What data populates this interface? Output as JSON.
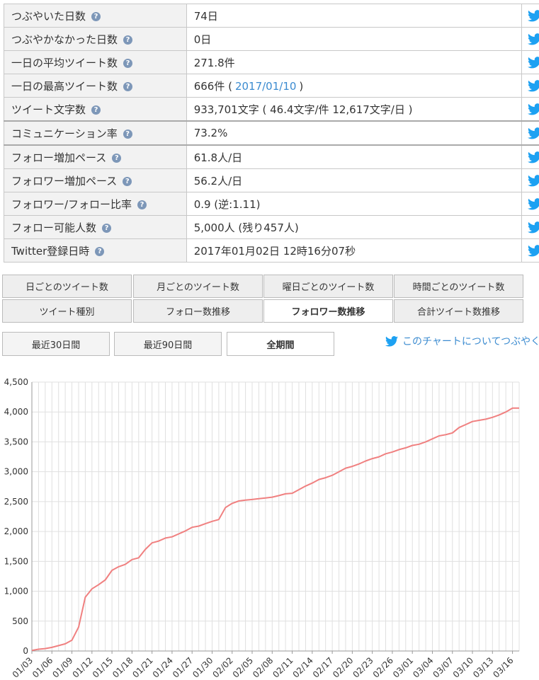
{
  "stats": [
    {
      "label": "つぶやいた日数",
      "value": "74日"
    },
    {
      "label": "つぶやかなかった日数",
      "value": "0日"
    },
    {
      "label": "一日の平均ツイート数",
      "value": "271.8件"
    },
    {
      "label": "一日の最高ツイート数",
      "value_pre": "666件 (",
      "value_link": "2017/01/10",
      "value_post": ")"
    },
    {
      "label": "ツイート文字数",
      "value": "933,701文字 ( 46.4文字/件 12,617文字/日 )"
    },
    {
      "label": "コミュニケーション率",
      "value": "73.2%"
    },
    {
      "label": "フォロー増加ペース",
      "value": "61.8人/日"
    },
    {
      "label": "フォロワー増加ペース",
      "value": "56.2人/日"
    },
    {
      "label": "フォロワー/フォロー比率",
      "value": "0.9 (逆:1.11)"
    },
    {
      "label": "フォロー可能人数",
      "value": "5,000人 (残り457人)"
    },
    {
      "label": "Twitter登録日時",
      "value": "2017年01月02日 12時16分07秒"
    }
  ],
  "help_glyph": "?",
  "tabs": {
    "row1": [
      "日ごとのツイート数",
      "月ごとのツイート数",
      "曜日ごとのツイート数",
      "時間ごとのツイート数"
    ],
    "row2": [
      "ツイート種別",
      "フォロー数推移",
      "フォロワー数推移",
      "合計ツイート数推移"
    ],
    "active": "フォロワー数推移"
  },
  "periods": {
    "labels": [
      "最近30日間",
      "最近90日間",
      "全期間"
    ],
    "active": "全期間"
  },
  "tweet_chart_link": "このチャートについてつぶやく",
  "colors": {
    "line": "#f08080",
    "twitter": "#1da1f2",
    "link": "#3b8bd0",
    "grid": "#e0e0e0",
    "axis": "#999999"
  },
  "chart_data": {
    "type": "line",
    "title": "",
    "xlabel": "",
    "ylabel": "",
    "ylim": [
      0,
      4500
    ],
    "yticks": [
      0,
      500,
      1000,
      1500,
      2000,
      2500,
      3000,
      3500,
      4000,
      4500
    ],
    "grid": true,
    "legend": "none",
    "x_tick_labels": [
      "01/03",
      "01/06",
      "01/09",
      "01/12",
      "01/15",
      "01/18",
      "01/21",
      "01/24",
      "01/27",
      "01/30",
      "02/02",
      "02/05",
      "02/08",
      "02/11",
      "02/14",
      "02/17",
      "02/20",
      "02/23",
      "02/26",
      "03/01",
      "03/04",
      "03/07",
      "03/10",
      "03/13",
      "03/16"
    ],
    "series": [
      {
        "x": [
          "01/03",
          "01/04",
          "01/05",
          "01/06",
          "01/07",
          "01/08",
          "01/09",
          "01/10",
          "01/11",
          "01/12",
          "01/13",
          "01/14",
          "01/15",
          "01/16",
          "01/17",
          "01/18",
          "01/19",
          "01/20",
          "01/21",
          "01/22",
          "01/23",
          "01/24",
          "01/25",
          "01/26",
          "01/27",
          "01/28",
          "01/29",
          "01/30",
          "01/31",
          "02/01",
          "02/02",
          "02/03",
          "02/04",
          "02/05",
          "02/06",
          "02/07",
          "02/08",
          "02/09",
          "02/10",
          "02/11",
          "02/12",
          "02/13",
          "02/14",
          "02/15",
          "02/16",
          "02/17",
          "02/18",
          "02/19",
          "02/20",
          "02/21",
          "02/22",
          "02/23",
          "02/24",
          "02/25",
          "02/26",
          "02/27",
          "02/28",
          "03/01",
          "03/02",
          "03/03",
          "03/04",
          "03/05",
          "03/06",
          "03/07",
          "03/08",
          "03/09",
          "03/10",
          "03/11",
          "03/12",
          "03/13",
          "03/14",
          "03/15",
          "03/16",
          "03/17"
        ],
        "values": [
          10,
          30,
          40,
          60,
          90,
          120,
          180,
          400,
          900,
          1040,
          1110,
          1190,
          1350,
          1410,
          1450,
          1530,
          1560,
          1700,
          1810,
          1840,
          1890,
          1910,
          1960,
          2010,
          2070,
          2090,
          2130,
          2170,
          2200,
          2400,
          2470,
          2510,
          2525,
          2535,
          2550,
          2560,
          2575,
          2600,
          2630,
          2640,
          2700,
          2760,
          2810,
          2870,
          2900,
          2940,
          3000,
          3060,
          3090,
          3130,
          3180,
          3220,
          3250,
          3300,
          3330,
          3370,
          3400,
          3440,
          3460,
          3500,
          3550,
          3600,
          3620,
          3650,
          3740,
          3790,
          3840,
          3860,
          3880,
          3910,
          3950,
          4000,
          4065,
          4065
        ]
      }
    ]
  }
}
